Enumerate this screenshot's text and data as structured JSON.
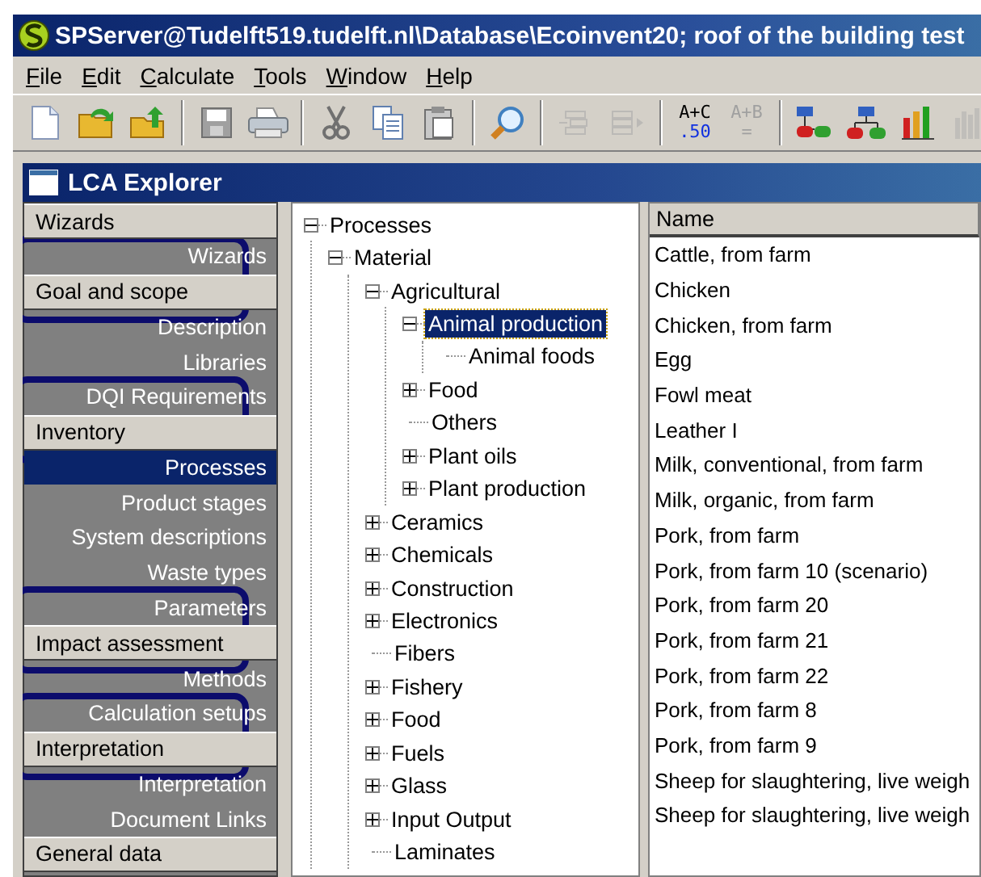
{
  "window": {
    "title": "SPServer@Tudelft519.tudelft.nl\\Database\\Ecoinvent20; roof of the building test"
  },
  "menu": [
    "File",
    "Edit",
    "Calculate",
    "Tools",
    "Window",
    "Help"
  ],
  "toolbar": [
    [
      {
        "kind": "icon",
        "disabled": false
      },
      {
        "kind": "icon",
        "disabled": false
      },
      {
        "kind": "icon",
        "disabled": false
      }
    ],
    [
      {
        "kind": "icon",
        "disabled": false
      },
      {
        "kind": "icon",
        "disabled": false
      }
    ],
    [
      {
        "kind": "icon",
        "disabled": false
      },
      {
        "kind": "icon",
        "disabled": false
      },
      {
        "kind": "icon",
        "disabled": false
      }
    ],
    [
      {
        "kind": "icon",
        "disabled": false
      }
    ],
    [
      {
        "kind": "icon",
        "disabled": true
      },
      {
        "kind": "icon",
        "disabled": true
      }
    ],
    [
      {
        "kind": "text",
        "top": "A+C",
        "bottom": ".50",
        "disabled": false
      },
      {
        "kind": "text",
        "top": "A+B",
        "bottom": "=",
        "disabled": true
      }
    ],
    [
      {
        "kind": "icon",
        "disabled": false
      },
      {
        "kind": "icon",
        "disabled": false
      },
      {
        "kind": "icon",
        "disabled": false
      },
      {
        "kind": "icon",
        "disabled": true
      }
    ]
  ],
  "explorer": {
    "title": "LCA Explorer"
  },
  "sidebar": [
    {
      "label": "Wizards",
      "highlighted": false,
      "items": [
        {
          "label": "Wizards",
          "selected": false
        }
      ]
    },
    {
      "label": "Goal and scope",
      "highlighted": true,
      "items": [
        {
          "label": "Description",
          "selected": false
        },
        {
          "label": "Libraries",
          "selected": false
        },
        {
          "label": "DQI Requirements",
          "selected": false
        }
      ]
    },
    {
      "label": "Inventory",
      "highlighted": true,
      "items": [
        {
          "label": "Processes",
          "selected": true
        },
        {
          "label": "Product stages",
          "selected": false
        },
        {
          "label": "System descriptions",
          "selected": false
        },
        {
          "label": "Waste types",
          "selected": false
        },
        {
          "label": "Parameters",
          "selected": false
        }
      ]
    },
    {
      "label": "Impact assessment",
      "highlighted": true,
      "items": [
        {
          "label": "Methods",
          "selected": false
        },
        {
          "label": "Calculation setups",
          "selected": false
        }
      ]
    },
    {
      "label": "Interpretation",
      "highlighted": true,
      "items": [
        {
          "label": "Interpretation",
          "selected": false
        },
        {
          "label": "Document Links",
          "selected": false
        }
      ]
    },
    {
      "label": "General data",
      "highlighted": false
    }
  ],
  "tree": [
    {
      "label": "Processes",
      "kind": "node",
      "expanded": true,
      "selected": false,
      "children": [
        {
          "label": "Material",
          "kind": "node",
          "expanded": true,
          "selected": false,
          "children": [
            {
              "label": "Agricultural",
              "kind": "node",
              "expanded": true,
              "selected": false,
              "children": [
                {
                  "label": "Animal production",
                  "kind": "node",
                  "expanded": true,
                  "selected": true,
                  "children": [
                    {
                      "label": "Animal foods",
                      "kind": "leaf",
                      "selected": false
                    }
                  ]
                },
                {
                  "label": "Food",
                  "kind": "node",
                  "expanded": false,
                  "selected": false
                },
                {
                  "label": "Others",
                  "kind": "leaf",
                  "selected": false
                },
                {
                  "label": "Plant oils",
                  "kind": "node",
                  "expanded": false,
                  "selected": false
                },
                {
                  "label": "Plant production",
                  "kind": "node",
                  "expanded": false,
                  "selected": false
                }
              ]
            },
            {
              "label": "Ceramics",
              "kind": "node",
              "expanded": false,
              "selected": false
            },
            {
              "label": "Chemicals",
              "kind": "node",
              "expanded": false,
              "selected": false
            },
            {
              "label": "Construction",
              "kind": "node",
              "expanded": false,
              "selected": false
            },
            {
              "label": "Electronics",
              "kind": "node",
              "expanded": false,
              "selected": false
            },
            {
              "label": "Fibers",
              "kind": "leaf",
              "selected": false
            },
            {
              "label": "Fishery",
              "kind": "node",
              "expanded": false,
              "selected": false
            },
            {
              "label": "Food",
              "kind": "node",
              "expanded": false,
              "selected": false
            },
            {
              "label": "Fuels",
              "kind": "node",
              "expanded": false,
              "selected": false
            },
            {
              "label": "Glass",
              "kind": "node",
              "expanded": false,
              "selected": false
            },
            {
              "label": "Input Output",
              "kind": "node",
              "expanded": false,
              "selected": false
            },
            {
              "label": "Laminates",
              "kind": "leaf",
              "selected": false
            }
          ]
        }
      ]
    }
  ],
  "table": {
    "columns": [
      "Name"
    ],
    "rows": [
      "Cattle, from farm",
      "Chicken",
      "Chicken, from farm",
      "Egg",
      "Fowl meat",
      "Leather I",
      "Milk, conventional, from farm",
      "Milk, organic, from farm",
      "Pork, from farm",
      "Pork, from farm 10 (scenario)",
      "Pork, from farm 20",
      "Pork, from farm 21",
      "Pork, from farm 22",
      "Pork, from farm 8",
      "Pork, from farm 9",
      "Sheep for slaughtering, live weigh",
      "Sheep for slaughtering, live weigh"
    ]
  }
}
